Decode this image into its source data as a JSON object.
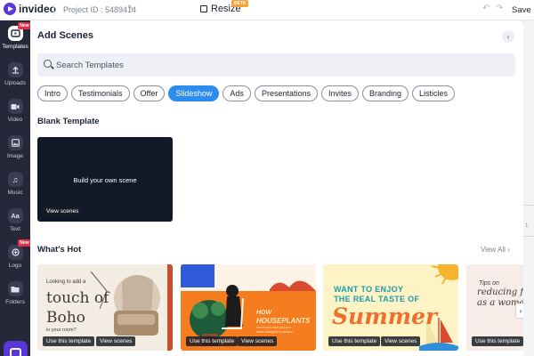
{
  "topbar": {
    "brand": "invideo",
    "project_id": "Project ID : 5489414",
    "resize_label": "Resize",
    "beta_badge": "BETA",
    "save_label": "Save"
  },
  "sidebar": {
    "items": [
      {
        "label": "Templates",
        "icon": "templates-icon",
        "active": true,
        "badge": "New"
      },
      {
        "label": "Uploads",
        "icon": "upload-icon"
      },
      {
        "label": "Video",
        "icon": "video-icon"
      },
      {
        "label": "Image",
        "icon": "image-icon"
      },
      {
        "label": "Music",
        "icon": "music-icon"
      },
      {
        "label": "Text",
        "icon": "text-icon",
        "glyph": "Aa"
      },
      {
        "label": "Logo",
        "icon": "logo-icon",
        "badge": "New"
      },
      {
        "label": "Folders",
        "icon": "folder-icon"
      }
    ]
  },
  "panel": {
    "title": "Add Scenes",
    "search_placeholder": "Search Templates",
    "categories": [
      "Intro",
      "Testimonials",
      "Offer",
      "Slideshow",
      "Ads",
      "Presentations",
      "Invites",
      "Branding",
      "Listicles"
    ],
    "active_category": "Slideshow",
    "blank_section_title": "Blank Template",
    "blank_card_text": "Build your own scene",
    "view_scenes_label": "View scenes",
    "use_template_label": "Use this template",
    "hot_section_title": "What's Hot",
    "view_all_label": "View All",
    "templates": [
      {
        "lines": [
          "Looking to add a",
          "touch of",
          "Boho",
          "in your room?"
        ],
        "bg": "#f4ede4"
      },
      {
        "lines": [
          "HOW",
          "HOUSEPLANTS",
          "boost more than just your",
          "decor during the lockdown"
        ],
        "bg": "#f57c1f"
      },
      {
        "lines": [
          "WANT TO ENJOY",
          "THE REAL TASTE OF",
          "Summer"
        ],
        "bg": "#fdf3c4"
      },
      {
        "lines": [
          "Tips on",
          "reducing fa",
          "as a woma"
        ],
        "bg": "#f7ece8"
      }
    ]
  },
  "backdrop": {
    "text": "1"
  },
  "colors": {
    "accent": "#5a37d9",
    "chip_active": "#2d8cf0",
    "sidebar_bg": "#252838"
  }
}
